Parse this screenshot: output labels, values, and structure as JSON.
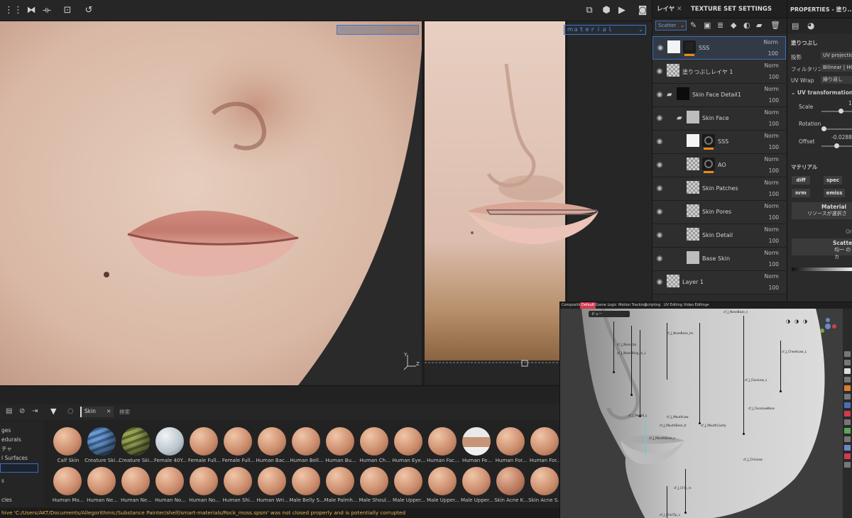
{
  "viewports": {
    "left_channel": "ｍａｔｅｒｉａｌ",
    "right_channel": "ｍａｔｅｒｉａｌ",
    "axis_z": "Z",
    "axis_y": "Y"
  },
  "layers_panel": {
    "tab_layers": "レイヤ",
    "tab_texture_set": "TEXTURE SET SETTINGS",
    "channel_select": "Scatter",
    "rows": [
      {
        "name": "SSS",
        "blend": "Norm",
        "opacity": "100"
      },
      {
        "name": "塗りつぶしレイヤ 1",
        "blend": "Norm",
        "opacity": "100"
      },
      {
        "name": "Skin Face Detail1",
        "blend": "Norm",
        "opacity": "100"
      },
      {
        "name": "Skin Face",
        "blend": "Norm",
        "opacity": "100"
      },
      {
        "name": "SSS",
        "blend": "Norm",
        "opacity": "100"
      },
      {
        "name": "AO",
        "blend": "Norm",
        "opacity": "100"
      },
      {
        "name": "Skin Patches",
        "blend": "Norm",
        "opacity": "100"
      },
      {
        "name": "Skin Pores",
        "blend": "Norm",
        "opacity": "100"
      },
      {
        "name": "Skin Detail",
        "blend": "Norm",
        "opacity": "100"
      },
      {
        "name": "Base Skin",
        "blend": "Norm",
        "opacity": "100"
      },
      {
        "name": "Layer 1",
        "blend": "Norm",
        "opacity": "100"
      }
    ]
  },
  "properties": {
    "title": "PROPERTIES - 塗り...",
    "section_fill": "塗りつぶし",
    "projection_label": "投影",
    "projection_value": "UV projection",
    "filter_label": "フィルタリング",
    "filter_value": "Bilinear | HQ",
    "uvwrap_label": "UV Wrap",
    "uvwrap_value": "繰り返し",
    "uvtrans_title": "UV transformations",
    "scale_label": "Scale",
    "scale_value": "1",
    "rotation_label": "Rotation",
    "offset_label": "Offset",
    "offset_value": "-0.0288",
    "material_title": "マテリアル",
    "chips": [
      "diff",
      "spec",
      "nrm",
      "emiss"
    ],
    "material_btn_title": "Material",
    "material_btn_sub": "リソースが選択さ",
    "or_text": "Or",
    "scatter_btn_title": "Scatte",
    "scatter_btn_sub": "均一 のカ"
  },
  "shelf": {
    "search_value": "Skin",
    "search_hint": "検索",
    "categories": [
      "ges",
      "edurals",
      "チャ",
      "l Surfaces",
      "",
      "s",
      "",
      "cles"
    ],
    "materials_row1": [
      "Calf Skin",
      "Creature Ski...",
      "Creature Ski...",
      "Female 40Y...",
      "Female Full...",
      "Female Full...",
      "Human Bac...",
      "Human Bell...",
      "Human Bu...",
      "Human Ch...",
      "Human Eye...",
      "Human Fac...",
      "Human Fe...",
      "Human For...",
      "Human For..."
    ],
    "materials_row2": [
      "Human Mo...",
      "Human Ne...",
      "Human Ne...",
      "Human No...",
      "Human No...",
      "Human Shi...",
      "Human Wri...",
      "Male Belly S...",
      "Male Palmh...",
      "Male Shoul...",
      "Male Upper...",
      "Male Upper...",
      "Male Upper...",
      "Skin Acne K...",
      "Skin Acne S..."
    ],
    "status": "hive 'C:/Users/AKT/Documents/Allegorithmic/Substance Painter/shelf/smart-materials/Rock_moss.spsm' was not closed properly and is potentially corrupted"
  },
  "blender": {
    "tabs": [
      "Compositing",
      "Default",
      "Game Logic",
      "Motion Tracking",
      "Scripting",
      "UV Editing",
      "Video Editing",
      "+"
    ],
    "header_menu": "ビュー",
    "bone_labels": [
      "cf_J_NoseBase_s",
      "cf_J_NoseBase_trs",
      "cf_J_Nose_tip",
      "cf_J_NoseWing_tx_L",
      "cf_J_CheekLow_L",
      "cf_J_FaceLow_s",
      "cf_J_Mouth_L",
      "cf_J_MouthLow",
      "cf_J_MouthBase_tr",
      "cf_J_MouthCavity",
      "cf_J_FaceLowBase",
      "cf_J_MouthBase_s",
      "cf_J_ChinLow",
      "cf_J_Chin_rs",
      "cf_J_ChinTip_s"
    ]
  }
}
